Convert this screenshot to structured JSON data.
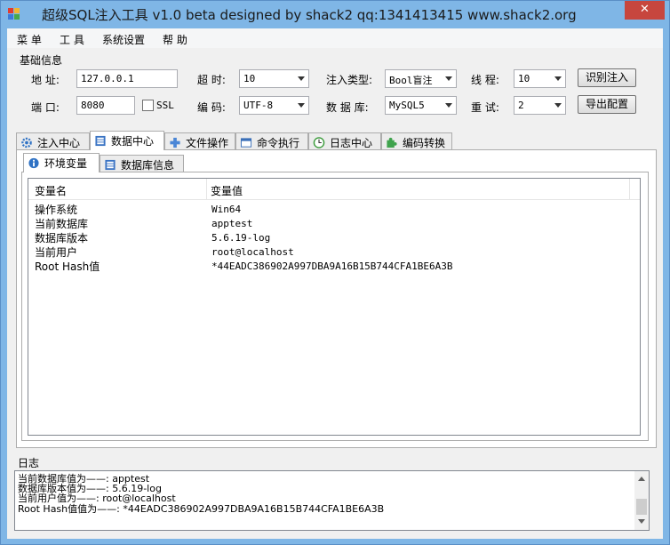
{
  "window": {
    "title": "超级SQL注入工具 v1.0 beta designed by shack2 qq:1341413415 www.shack2.org",
    "close_glyph": "✕"
  },
  "menu": [
    "菜 单",
    "工 具",
    "系统设置",
    "帮 助"
  ],
  "basic_info": {
    "title": "基础信息",
    "address_label": "地  址:",
    "address_value": "127.0.0.1",
    "port_label": "端  口:",
    "port_value": "8080",
    "ssl_label": "SSL",
    "timeout_label": "超 时:",
    "timeout_value": "10",
    "encoding_label": "编 码:",
    "encoding_value": "UTF-8",
    "inject_type_label": "注入类型:",
    "inject_type_value": "Bool盲注",
    "database_label": "数 据 库:",
    "database_value": "MySQL5",
    "threads_label": "线 程:",
    "threads_value": "10",
    "retry_label": "重 试:",
    "retry_value": "2",
    "identify_button": "识别注入",
    "export_button": "导出配置"
  },
  "tabs": [
    {
      "label": "注入中心",
      "icon": "gear-icon"
    },
    {
      "label": "数据中心",
      "icon": "database-icon",
      "active": true
    },
    {
      "label": "文件操作",
      "icon": "file-plus-icon"
    },
    {
      "label": "命令执行",
      "icon": "terminal-window-icon"
    },
    {
      "label": "日志中心",
      "icon": "clock-icon"
    },
    {
      "label": "编码转换",
      "icon": "puzzle-icon"
    }
  ],
  "subtabs": [
    {
      "label": "环境变量",
      "icon": "info-icon",
      "active": true
    },
    {
      "label": "数据库信息",
      "icon": "database-icon"
    }
  ],
  "env_table": {
    "columns": [
      "变量名",
      "变量值"
    ],
    "rows": [
      [
        "操作系统",
        "Win64"
      ],
      [
        "当前数据库",
        "apptest"
      ],
      [
        "数据库版本",
        "5.6.19-log"
      ],
      [
        "当前用户",
        "root@localhost"
      ],
      [
        "Root Hash值",
        "*44EADC386902A997DBA9A16B15B744CFA1BE6A3B"
      ]
    ]
  },
  "log": {
    "title": "日志",
    "lines": [
      "当前数据库值为——: apptest",
      "数据库版本值为——: 5.6.19-log",
      "当前用户值为——: root@localhost",
      "Root Hash值值为——: *44EADC386902A997DBA9A16B15B744CFA1BE6A3B"
    ]
  },
  "colors": {
    "title_bar": "#7fb6e6",
    "close_button": "#c7463e",
    "client_bg": "#f0f0f0"
  }
}
